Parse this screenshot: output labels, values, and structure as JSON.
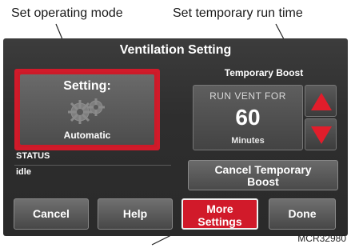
{
  "annotations": {
    "operating_mode": "Set operating mode",
    "temporary_run_time": "Set temporary run time"
  },
  "screen": {
    "title": "Ventilation Setting",
    "setting": {
      "label": "Setting:",
      "value": "Automatic",
      "icon": "gears-icon"
    },
    "status": {
      "label": "STATUS",
      "value": "idle"
    },
    "temporary_boost": {
      "label": "Temporary Boost",
      "run_label": "RUN VENT FOR",
      "run_value": "60",
      "run_unit": "Minutes",
      "cancel_label": "Cancel Temporary\nBoost"
    },
    "buttons": {
      "cancel": "Cancel",
      "help": "Help",
      "more_settings": "More\nSettings",
      "done": "Done"
    }
  },
  "reference_code": "MCR32980",
  "colors": {
    "highlight": "#d11a2a",
    "panel": "#2e2e2e"
  }
}
